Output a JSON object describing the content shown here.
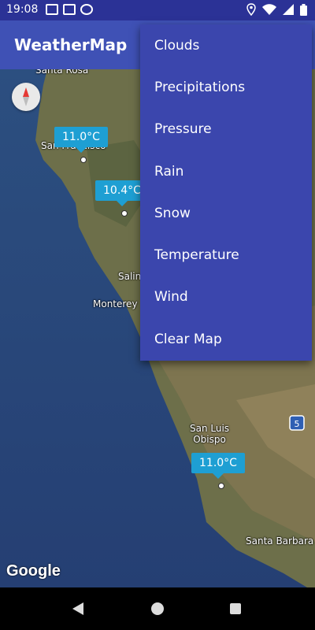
{
  "status_bar": {
    "time": "19:08",
    "left_icons": [
      "gmail-icon",
      "calendar-icon",
      "app-notification-icon"
    ],
    "right_icons": [
      "location-icon",
      "wifi-icon",
      "signal-icon",
      "battery-icon"
    ]
  },
  "app_bar": {
    "title": "WeatherMap"
  },
  "menu": {
    "items": [
      {
        "label": "Clouds"
      },
      {
        "label": "Precipitations"
      },
      {
        "label": "Pressure"
      },
      {
        "label": "Rain"
      },
      {
        "label": "Snow"
      },
      {
        "label": "Temperature"
      },
      {
        "label": "Wind"
      },
      {
        "label": "Clear Map"
      }
    ]
  },
  "map": {
    "cities": [
      {
        "name": "Santa Rosa"
      },
      {
        "name": "San Francisco"
      },
      {
        "name": "Salinas"
      },
      {
        "name": "Monterey"
      },
      {
        "name": "San Luis Obispo"
      },
      {
        "name": "Santa Barbara"
      }
    ],
    "markers": [
      {
        "label": "11.0°C"
      },
      {
        "label": "10.4°C"
      },
      {
        "label": "11.0°C"
      }
    ],
    "highway_shield": "5",
    "attribution": "Google"
  },
  "colors": {
    "status_bar": "#2b3296",
    "app_bar": "#3f51b5",
    "menu": "#3b46ad",
    "marker": "#1e9fd3"
  }
}
